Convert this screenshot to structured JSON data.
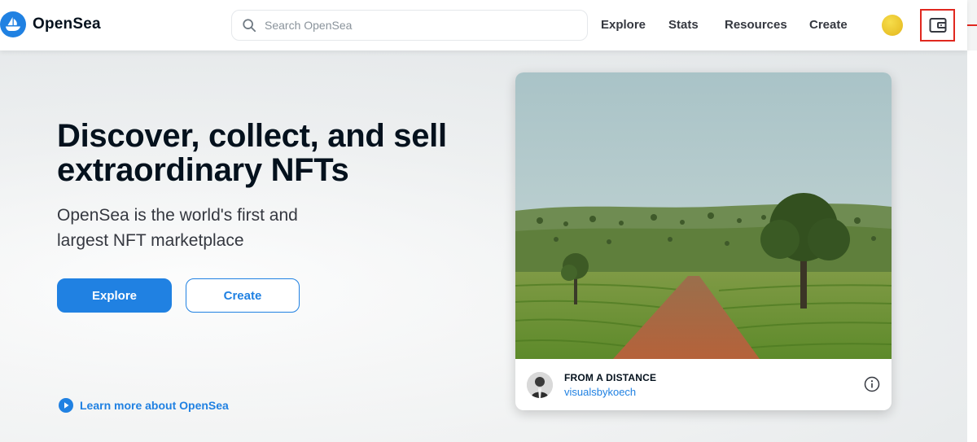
{
  "header": {
    "brand": "OpenSea",
    "search_placeholder": "Search OpenSea",
    "nav": [
      "Explore",
      "Stats",
      "Resources",
      "Create"
    ]
  },
  "hero": {
    "headline": "Discover, collect, and sell extraordinary NFTs",
    "subline": "OpenSea is the world's first and largest NFT marketplace",
    "primary_button": "Explore",
    "secondary_button": "Create",
    "learn_more": "Learn more about OpenSea"
  },
  "featured": {
    "title": "FROM A DISTANCE",
    "author": "visualsbykoech"
  },
  "icons": {
    "logo": "opensea-logo-icon",
    "search": "search-icon",
    "profile": "profile-avatar-icon",
    "wallet": "wallet-icon",
    "play": "play-circle-icon",
    "info": "info-icon"
  },
  "colors": {
    "accent": "#2081e2",
    "text": "#04111d",
    "highlight_box": "#e0281f"
  }
}
